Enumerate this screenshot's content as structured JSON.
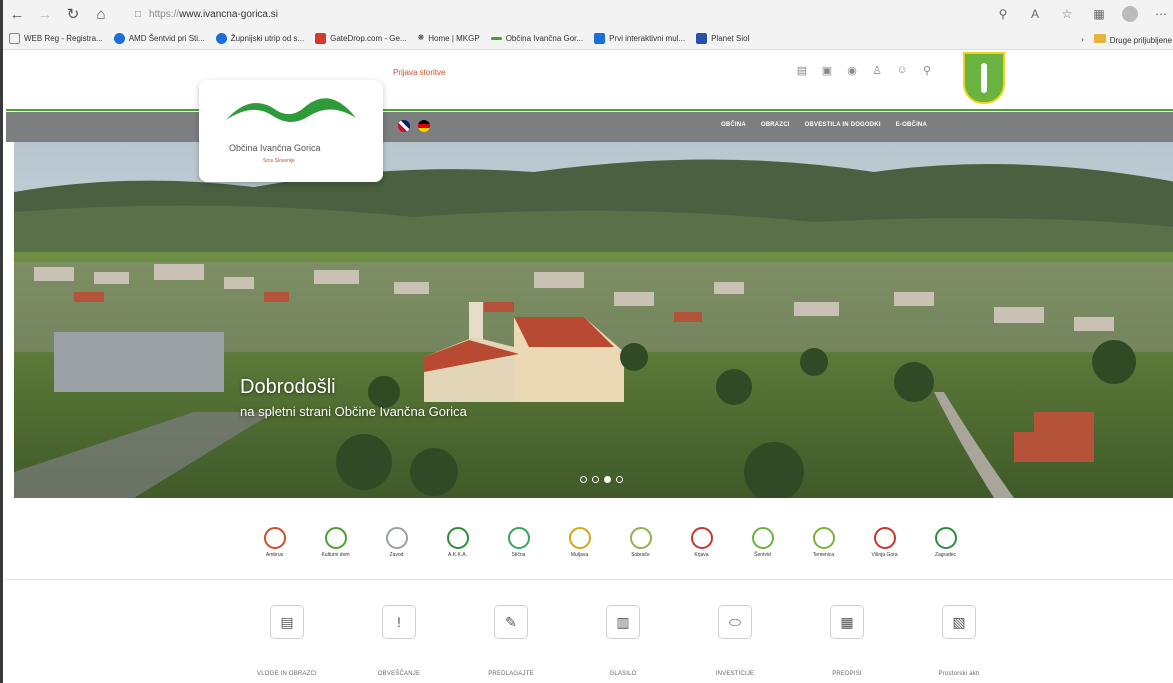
{
  "browser": {
    "url_protocol": "https://",
    "url_host": "www.ivancna-gorica.si",
    "bookmarks": [
      {
        "label": "WEB Reg - Registra...",
        "color": "#ffffff"
      },
      {
        "label": "AMD Šentvid pri Sti...",
        "color": "#1b6fd6"
      },
      {
        "label": "Župnijski utrip od s...",
        "color": "#1b6fd6"
      },
      {
        "label": "GateDrop.com - Ge...",
        "color": "#d23a2a"
      },
      {
        "label": "Home | MKGP",
        "color": "#333333"
      },
      {
        "label": "Občina Ivančna Gor...",
        "color": "#4aa02c"
      },
      {
        "label": "Prvi interaktivni mul...",
        "color": "#1b6fd6"
      },
      {
        "label": "Planet Siol",
        "color": "#2a4fa8"
      }
    ],
    "other_bookmarks": "Druge priljubljene"
  },
  "site": {
    "logo_name": "Občina Ivančna Gorica",
    "logo_tagline": "Srce Slovenije",
    "util_link": "Prijava storitve",
    "nav": [
      "OBČINA",
      "OBRAZCI",
      "OBVESTILA IN DOGODKI",
      "E-OBČINA"
    ],
    "hero_title": "Dobrodošli",
    "hero_subtitle": "na spletni strani Občine Ivančna Gorica",
    "partners": [
      {
        "label": "Ambrus",
        "color": "#d24b2a"
      },
      {
        "label": "Kulturni dom",
        "color": "#4aa02c"
      },
      {
        "label": "Zavod",
        "color": "#9aa0a6"
      },
      {
        "label": "A.K.K.A.",
        "color": "#2e8b3a"
      },
      {
        "label": "Stična",
        "color": "#3aa35a"
      },
      {
        "label": "Muljava",
        "color": "#d4a514"
      },
      {
        "label": "Sobrače",
        "color": "#8fb34a"
      },
      {
        "label": "Krjava",
        "color": "#c23a2a"
      },
      {
        "label": "Šentvid",
        "color": "#6ab33e"
      },
      {
        "label": "Temenica",
        "color": "#7ab33e"
      },
      {
        "label": "Višnja Gora",
        "color": "#c23a2a"
      },
      {
        "label": "Zagradec",
        "color": "#2e8b3a"
      }
    ],
    "quick_links": [
      {
        "label": "VLOGE IN OBRAZCI",
        "icon": "document-icon"
      },
      {
        "label": "OBVEŠČANJE",
        "icon": "alert-icon"
      },
      {
        "label": "PREDLAGAJTE",
        "icon": "pencil-icon"
      },
      {
        "label": "GLASILO",
        "icon": "clipboard-icon"
      },
      {
        "label": "INVESTICIJE",
        "icon": "handshake-icon"
      },
      {
        "label": "PREDPISI",
        "icon": "book-icon"
      },
      {
        "label": "Prostorski akti",
        "icon": "map-icon"
      }
    ]
  }
}
